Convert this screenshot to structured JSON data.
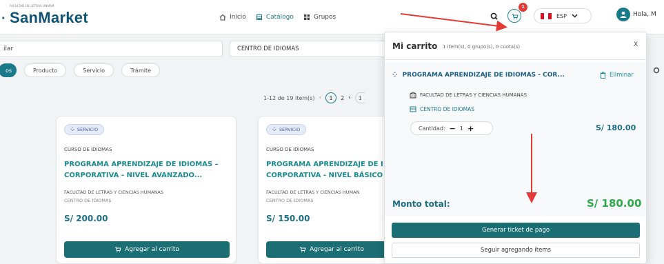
{
  "header": {
    "logo_small_text": "FACULTAD DE LETRAS UNMSM",
    "logo_text": "SanMarket",
    "nav": [
      {
        "label": "Inicio",
        "icon": "home-icon",
        "active": false
      },
      {
        "label": "Catálogo",
        "icon": "catalog-icon",
        "active": true
      },
      {
        "label": "Grupos",
        "icon": "groups-icon",
        "active": false
      }
    ],
    "cart_count": "1",
    "language": "ESP",
    "user_greeting": "Hola, M"
  },
  "filters": {
    "search_value": "ilar",
    "select_value": "CENTRO DE IDIOMAS",
    "chips": [
      "os",
      "Producto",
      "Servicio",
      "Trámite"
    ]
  },
  "pager": {
    "range": "1-12 de 19 item(s)",
    "prev": "‹",
    "current": "1",
    "next_page": "2",
    "next": "›",
    "last": "1"
  },
  "cards": [
    {
      "tag": "SERVICIO",
      "type": "CURSO DE IDIOMAS",
      "title_line1": "PROGRAMA APRENDIZAJE DE IDIOMAS –",
      "title_line2": "CORPORATIVA - NIVEL AVANZADO...",
      "faculty": "FACULTAD DE LETRAS Y CIENCIAS HUMANAS",
      "center": "CENTRO DE IDIOMAS",
      "price": "S/ 200.00",
      "button": "Agregar al carrito"
    },
    {
      "tag": "SERVICIO",
      "type": "CURSO DE IDIOMAS",
      "title_line1": "PROGRAMA APRENDIZAJE DE I",
      "title_line2": "CORPORATIVA - NIVEL BÁSICO",
      "faculty": "FACULTAD DE LETRAS Y CIENCIAS HUMAN",
      "center": "CENTRO DE IDIOMAS",
      "price": "S/ 150.00",
      "button": "Agregar al carrito"
    }
  ],
  "cart": {
    "title": "Mi carrito",
    "summary": "1 item(s), 0 grupo(s), 0 cuota(s)",
    "close": "X",
    "item": {
      "title": "PROGRAMA APRENDIZAJE DE IDIOMAS - COR...",
      "delete": "Eliminar",
      "faculty": "FACULTAD DE LETRAS Y CIENCIAS HUMANAS",
      "center": "CENTRO DE IDIOMAS",
      "qty_label": "Cantidad:",
      "minus": "−",
      "qty": "1",
      "plus": "+",
      "price": "S/ 180.00"
    },
    "total_label": "Monto total:",
    "total_value": "S/ 180.00",
    "primary_button": "Generar ticket de pago",
    "secondary_button": "Seguir agregando ítems"
  },
  "colors": {
    "brand_teal": "#1b6e74",
    "link_teal": "#1b8b92",
    "total_green": "#2ea84a",
    "badge_red": "#e53935",
    "annotation_red": "#e53935"
  }
}
